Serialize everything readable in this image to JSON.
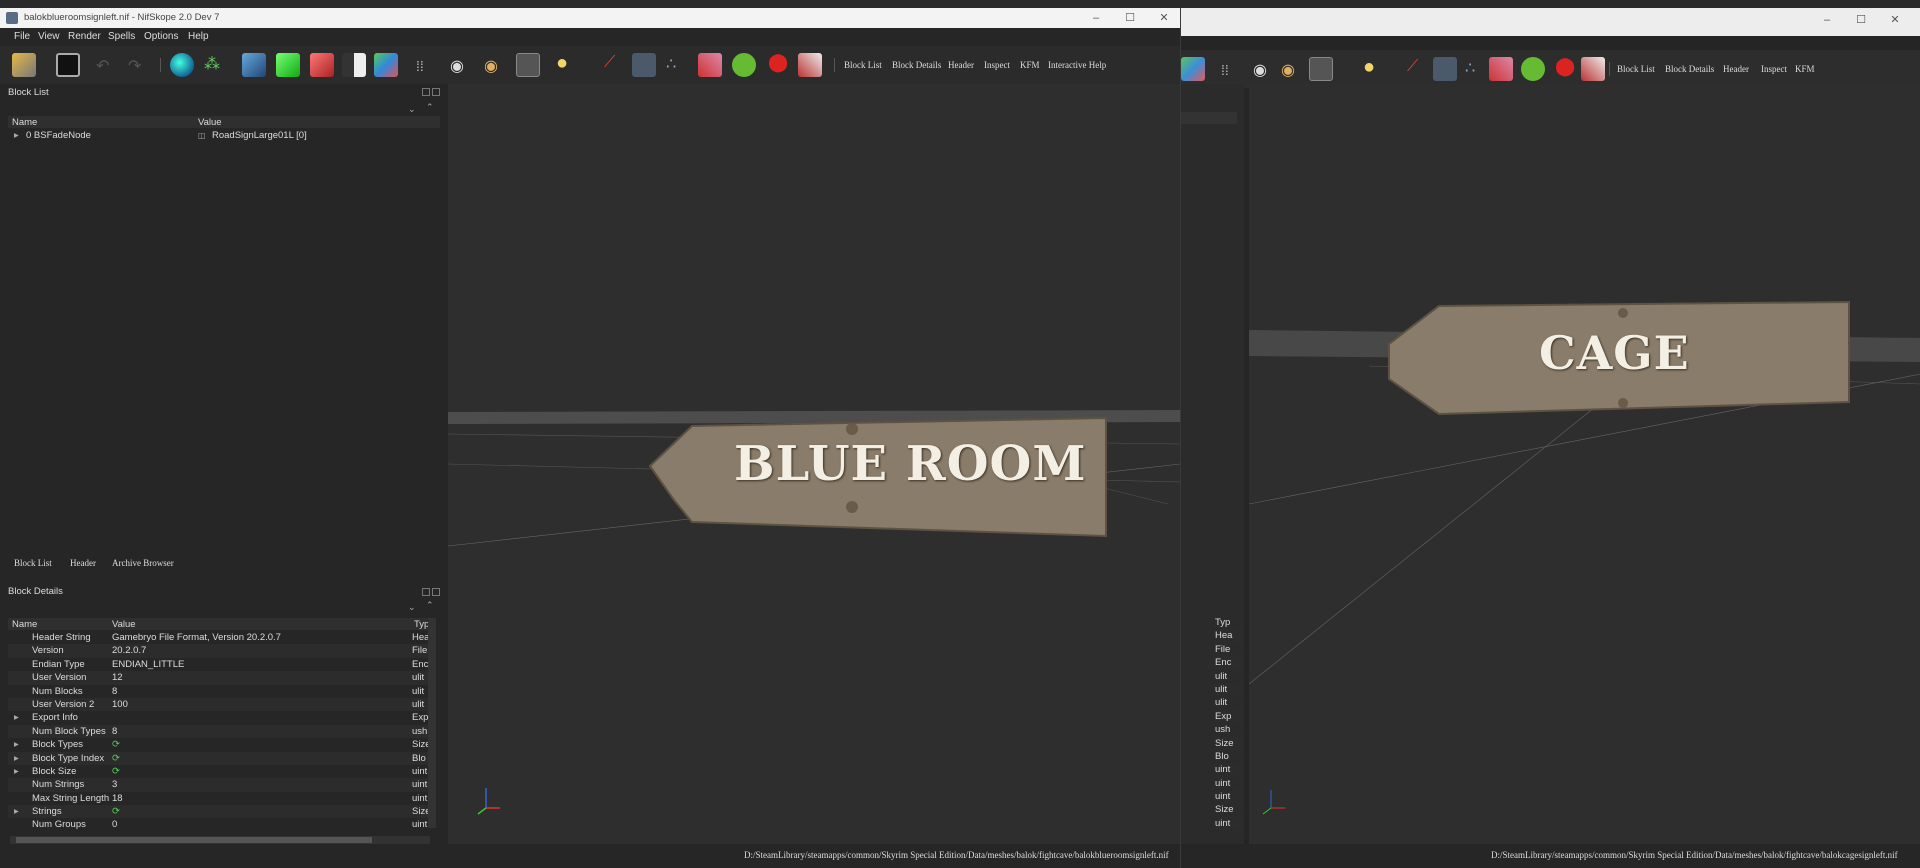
{
  "window": {
    "title": "balokblueroomsignleft.nif - NifSkope 2.0 Dev 7",
    "controls": [
      "–",
      "☐",
      "✕"
    ]
  },
  "menu": [
    "File",
    "View",
    "Render",
    "Spells",
    "Options",
    "Help"
  ],
  "toolbar": {
    "links": [
      "Block List",
      "Block Details",
      "Header",
      "Inspect",
      "KFM",
      "Interactive Help"
    ]
  },
  "toolbar2": {
    "links": [
      "Block List",
      "Block Details",
      "Header",
      "Inspect",
      "KFM"
    ]
  },
  "block_list": {
    "title": "Block List",
    "columns": [
      "Name",
      "Value"
    ],
    "rows": [
      {
        "name": "0 BSFadeNode",
        "value": "RoadSignLarge01L [0]"
      }
    ]
  },
  "tabs": [
    "Block List",
    "Header",
    "Archive Browser"
  ],
  "block_details": {
    "title": "Block Details",
    "columns": [
      "Name",
      "Value",
      "Typ"
    ],
    "rows": [
      {
        "name": "Header String",
        "value": "Gamebryo File Format, Version 20.2.0.7",
        "type": "Hea"
      },
      {
        "name": "Version",
        "value": "20.2.0.7",
        "type": "File"
      },
      {
        "name": "Endian Type",
        "value": "ENDIAN_LITTLE",
        "type": "Enc"
      },
      {
        "name": "User Version",
        "value": "12",
        "type": "ulit"
      },
      {
        "name": "Num Blocks",
        "value": "8",
        "type": "ulit"
      },
      {
        "name": "User Version 2",
        "value": "100",
        "type": "ulit"
      },
      {
        "name": "Export Info",
        "value": "",
        "type": "Exp"
      },
      {
        "name": "Num Block Types",
        "value": "8",
        "type": "ush"
      },
      {
        "name": "Block Types",
        "value": "",
        "type": "Size"
      },
      {
        "name": "Block Type Index",
        "value": "",
        "type": "Blo"
      },
      {
        "name": "Block Size",
        "value": "",
        "type": "uint"
      },
      {
        "name": "Num Strings",
        "value": "3",
        "type": "uint"
      },
      {
        "name": "Max String Length",
        "value": "18",
        "type": "uint"
      },
      {
        "name": "Strings",
        "value": "",
        "type": "Size"
      },
      {
        "name": "Num Groups",
        "value": "0",
        "type": "uint"
      }
    ],
    "expandable": [
      6,
      8,
      9,
      10,
      13
    ],
    "spinner_rows": [
      8,
      9,
      10,
      13
    ]
  },
  "back_window": {
    "details_type_col": [
      "Typ",
      "Hea",
      "File",
      "Enc",
      "ulit",
      "ulit",
      "ulit",
      "Exp",
      "ush",
      "Size",
      "Blo",
      "uint",
      "uint",
      "uint",
      "Size",
      "uint"
    ]
  },
  "viewport": {
    "sign_text": "BLUE ROOM",
    "status_path": "D:/SteamLibrary/steamapps/common/Skyrim Special Edition/Data/meshes/balok/fightcave/balokblueroomsignleft.nif"
  },
  "viewport2": {
    "sign_text": "CAGE",
    "status_path": "D:/SteamLibrary/steamapps/common/Skyrim Special Edition/Data/meshes/balok/fightcave/balokcagesignleft.nif"
  },
  "colors": {
    "bg": "#262626",
    "viewport": "#2e2e2e",
    "wood": "#8a7c6a",
    "text": "#f4efe4"
  }
}
